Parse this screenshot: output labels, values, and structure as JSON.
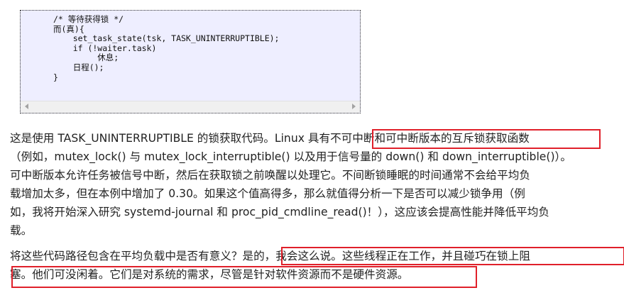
{
  "code": {
    "lines": [
      "/* 等待获得锁 */",
      "而(真){",
      "    set_task_state(tsk, TASK_UNINTERRUPTIBLE);",
      "    if (!waiter.task)",
      "         休息;",
      "    日程();",
      "}"
    ]
  },
  "paragraph1": {
    "lines": [
      "这是使用 TASK_UNINTERRUPTIBLE 的锁获取代码。Linux 具有不可中断和可中断版本的互斥锁获取函数",
      "（例如，mutex_lock() 与 mutex_lock_interruptible() 以及用于信号量的 down() 和 down_interruptible()）。",
      "可中断版本允许任务被信号中断，然后在获取锁之前唤醒以处理它。不间断锁睡眠的时间通常不会给平均负",
      "载增加太多，但在本例中增加了 0.30。如果这个值高得多，那么就值得分析一下是否可以减少锁争用（例",
      "如，我将开始深入研究 systemd-journal 和 proc_pid_cmdline_read()！），这应该会提高性能并降低平均负",
      "载。"
    ]
  },
  "paragraph2": {
    "lines": [
      "将这些代码路径包含在平均负载中是否有意义？是的，我会这么说。这些线程正在工作，并且碰巧在锁上阻",
      "塞。他们可没闲着。它们是对系统的需求，尽管是针对软件资源而不是硬件资源。"
    ]
  },
  "colors": {
    "code_background": "#eeeeff",
    "highlight_border": "#e0202a",
    "text": "#222222"
  }
}
